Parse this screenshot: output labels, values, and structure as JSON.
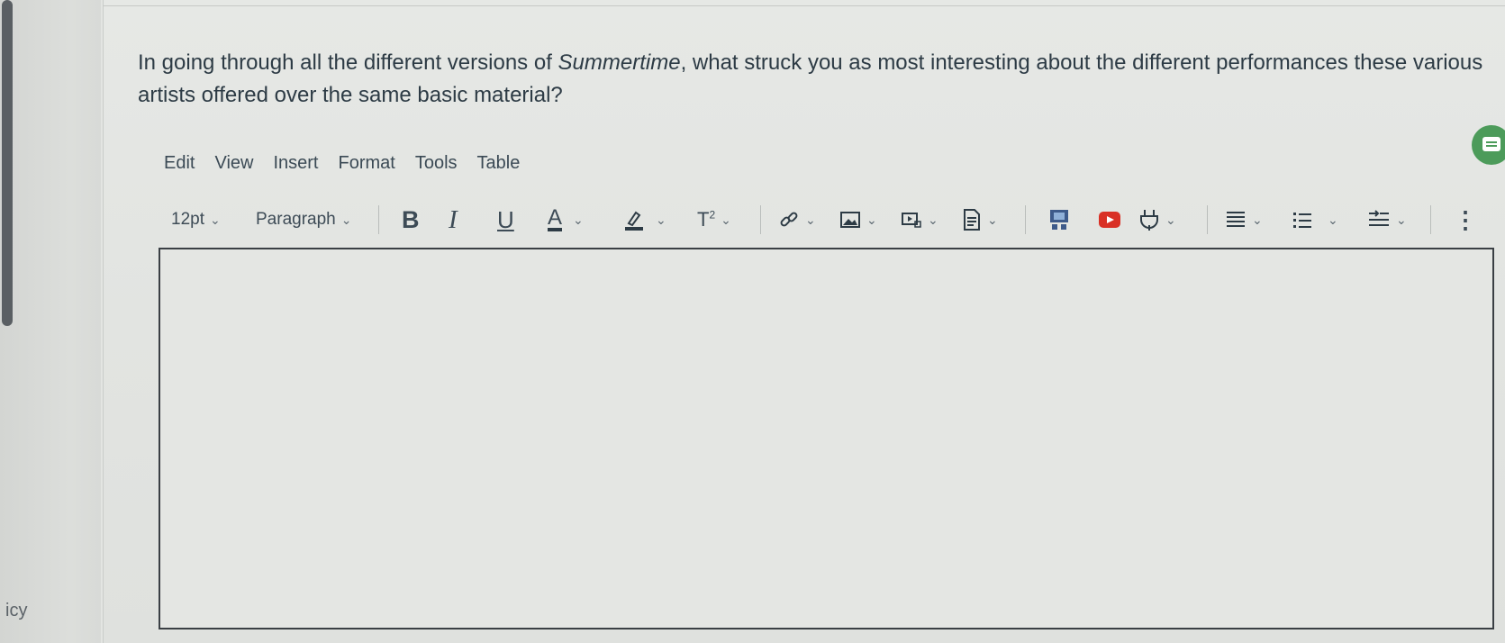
{
  "gutter": {
    "text": "icy"
  },
  "question": {
    "before": "In going through all the different versions of ",
    "italic": "Summertime",
    "after": ", what struck you as most interesting about the different performances these various artists offered over the same basic material?"
  },
  "menu": {
    "items": [
      "Edit",
      "View",
      "Insert",
      "Format",
      "Tools",
      "Table"
    ]
  },
  "toolbar": {
    "font_size": "12pt",
    "block_format": "Paragraph",
    "bold_label": "B",
    "italic_label": "I",
    "underline_label": "U",
    "font_color_label": "A",
    "superscript_label": "T",
    "superscript_mark": "2",
    "caret": "⌄",
    "more": "⋮"
  },
  "editor": {
    "value": ""
  },
  "colors": {
    "accent_green": "#4c9b5a",
    "youtube_red": "#d93025",
    "text": "#2d3b45"
  },
  "icons": [
    "link-icon",
    "image-icon",
    "media-icon",
    "document-icon",
    "apps-icon",
    "youtube-icon",
    "plug-icon",
    "align-icon",
    "list-icon",
    "indent-icon",
    "more-icon",
    "chat-icon"
  ]
}
